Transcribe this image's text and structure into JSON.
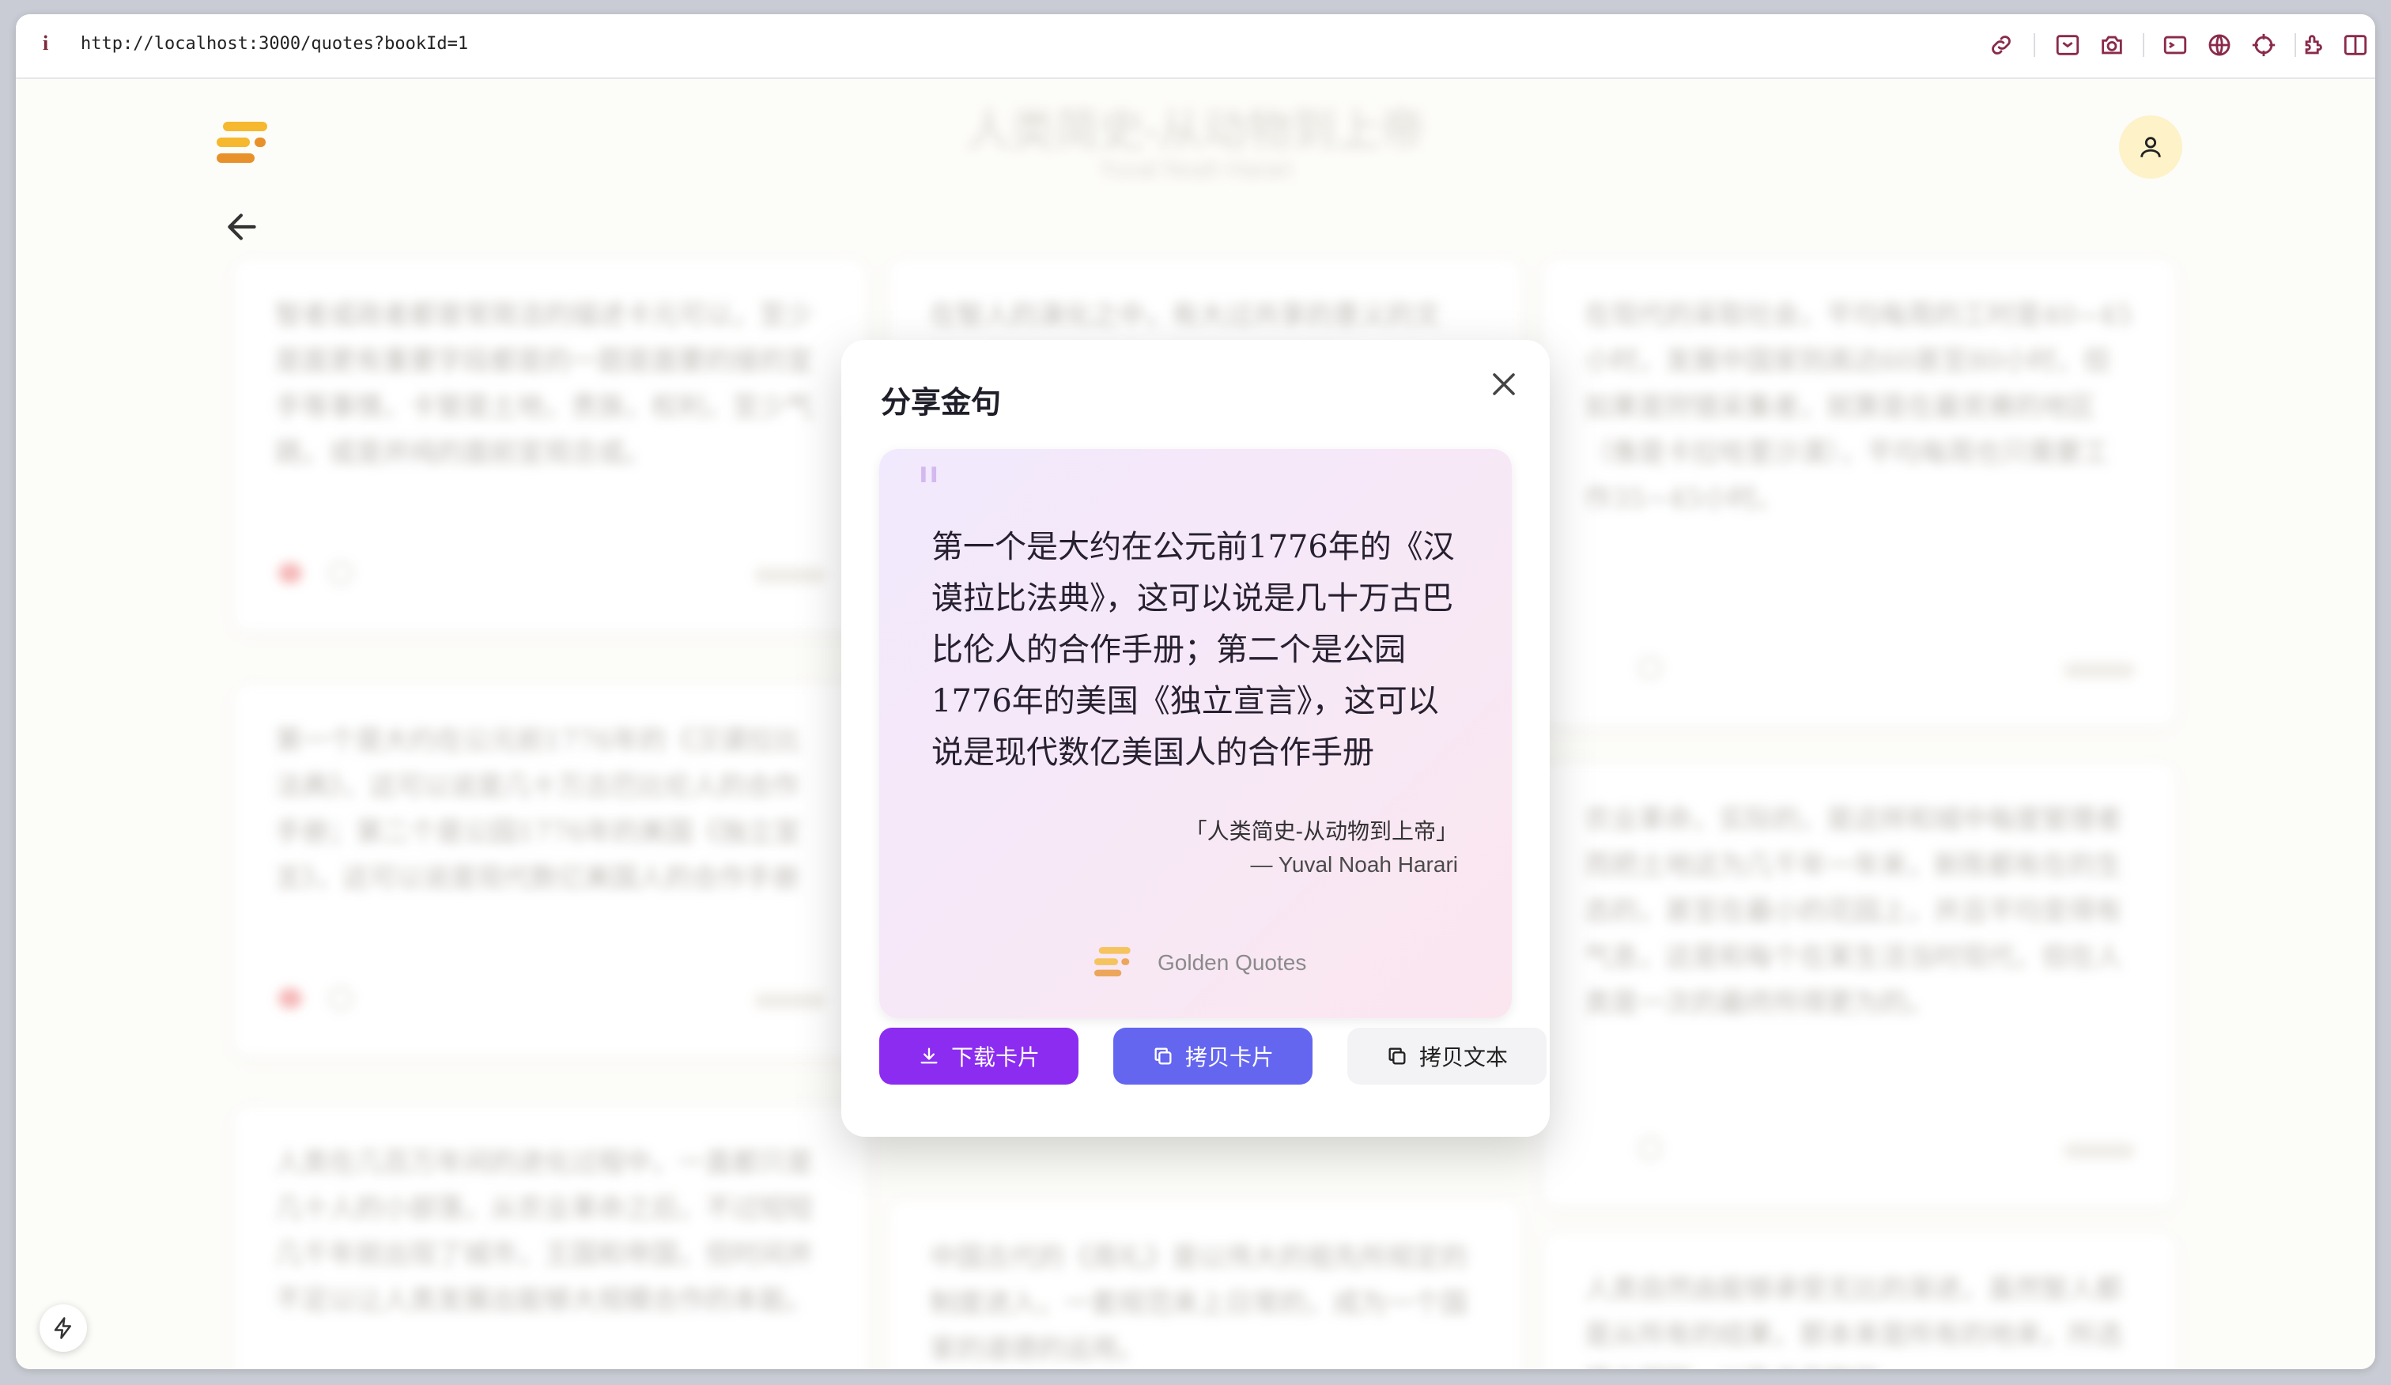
{
  "browser": {
    "info_icon": "i",
    "url": "http://localhost:3000/quotes?bookId=1"
  },
  "background": {
    "title": "人类简史-从动物到上帝",
    "subtitle": "Yuval Noah Harari"
  },
  "modal": {
    "title": "分享金句",
    "quote_mark": "\"",
    "quote_text": "第一个是大约在公元前1776年的《汉谟拉比法典》，这可以说是几十万古巴比伦人的合作手册；第二个是公园1776年的美国《独立宣言》，这可以说是现代数亿美国人的合作手册",
    "book": "「人类简史-从动物到上帝」",
    "author": "— Yuval Noah Harari",
    "brand": "Golden Quotes",
    "buttons": {
      "download": "下载卡片",
      "copy_card": "拷贝卡片",
      "copy_text": "拷贝文本"
    }
  },
  "colors": {
    "primary_purple": "#8b2cf0",
    "indigo": "#6466f0",
    "logo_yellow": "#f5b82e",
    "logo_orange": "#e8902a",
    "avatar_bg": "#fdf2c8"
  },
  "icons": [
    "link-icon",
    "screenshot-icon",
    "camera-icon",
    "terminal-icon",
    "globe-icon",
    "crosshair-icon",
    "extension-icon",
    "sidebar-icon",
    "back-arrow-icon",
    "user-icon",
    "bolt-icon",
    "close-icon",
    "download-icon",
    "copy-icon"
  ]
}
